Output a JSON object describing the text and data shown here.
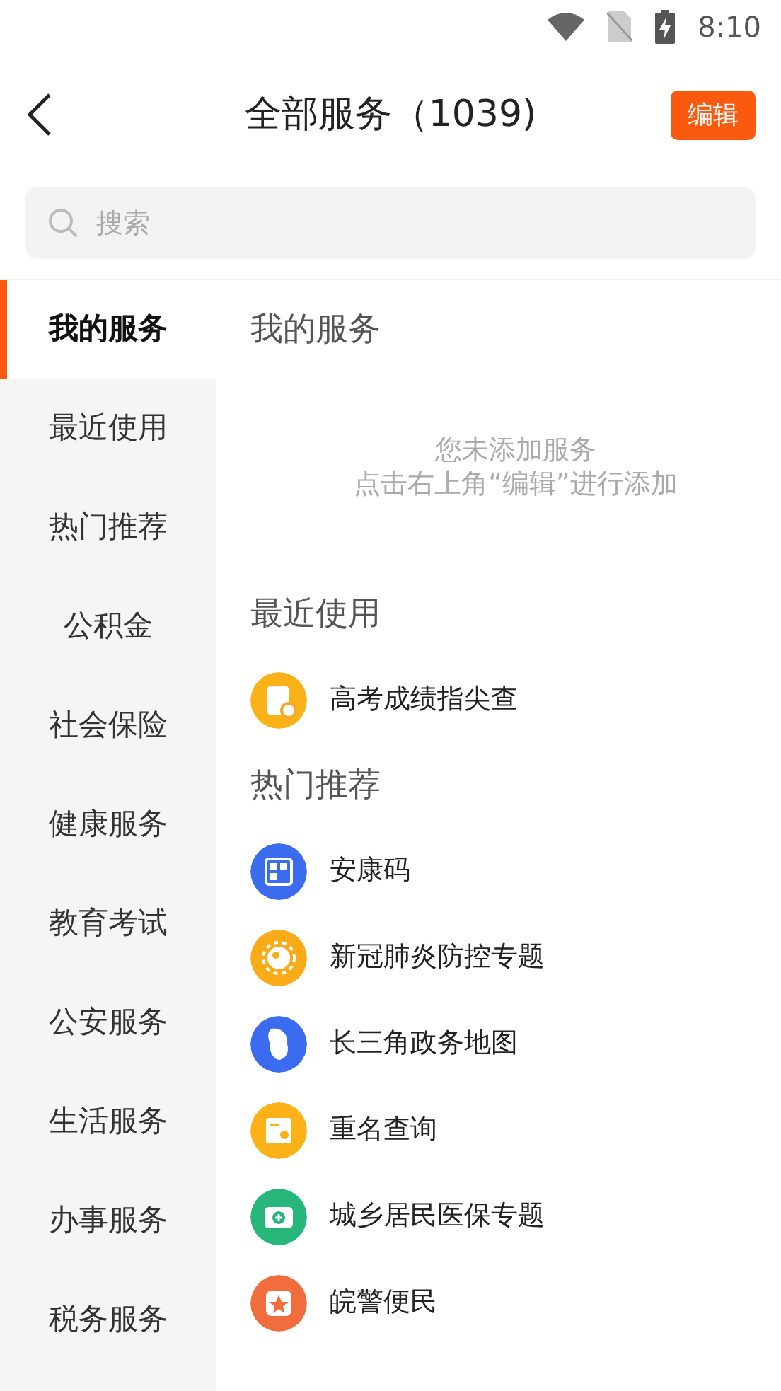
{
  "status_bar": {
    "time": "8:10"
  },
  "header": {
    "title": "全部服务（1039)",
    "edit_button": "编辑"
  },
  "search": {
    "placeholder": "搜索"
  },
  "sidebar": {
    "items": [
      {
        "label": "我的服务",
        "selected": true
      },
      {
        "label": "最近使用",
        "selected": false
      },
      {
        "label": "热门推荐",
        "selected": false
      },
      {
        "label": "公积金",
        "selected": false
      },
      {
        "label": "社会保险",
        "selected": false
      },
      {
        "label": "健康服务",
        "selected": false
      },
      {
        "label": "教育考试",
        "selected": false
      },
      {
        "label": "公安服务",
        "selected": false
      },
      {
        "label": "生活服务",
        "selected": false
      },
      {
        "label": "办事服务",
        "selected": false
      },
      {
        "label": "税务服务",
        "selected": false
      }
    ]
  },
  "sections": [
    {
      "title": "我的服务",
      "empty_lines": [
        "您未添加服务",
        "点击右上角“编辑”进行添加"
      ]
    },
    {
      "title": "最近使用",
      "services": [
        {
          "name": "高考成绩指尖查",
          "color": "#fbb118"
        }
      ]
    },
    {
      "title": "热门推荐",
      "services": [
        {
          "name": "安康码",
          "color": "#3b6cf0"
        },
        {
          "name": "新冠肺炎防控专题",
          "color": "#fbab18"
        },
        {
          "name": "长三角政务地图",
          "color": "#3b6cf0"
        },
        {
          "name": "重名查询",
          "color": "#fbb118"
        },
        {
          "name": "城乡居民医保专题",
          "color": "#27b77a"
        },
        {
          "name": "皖警便民",
          "color": "#f26d3d"
        }
      ]
    }
  ]
}
